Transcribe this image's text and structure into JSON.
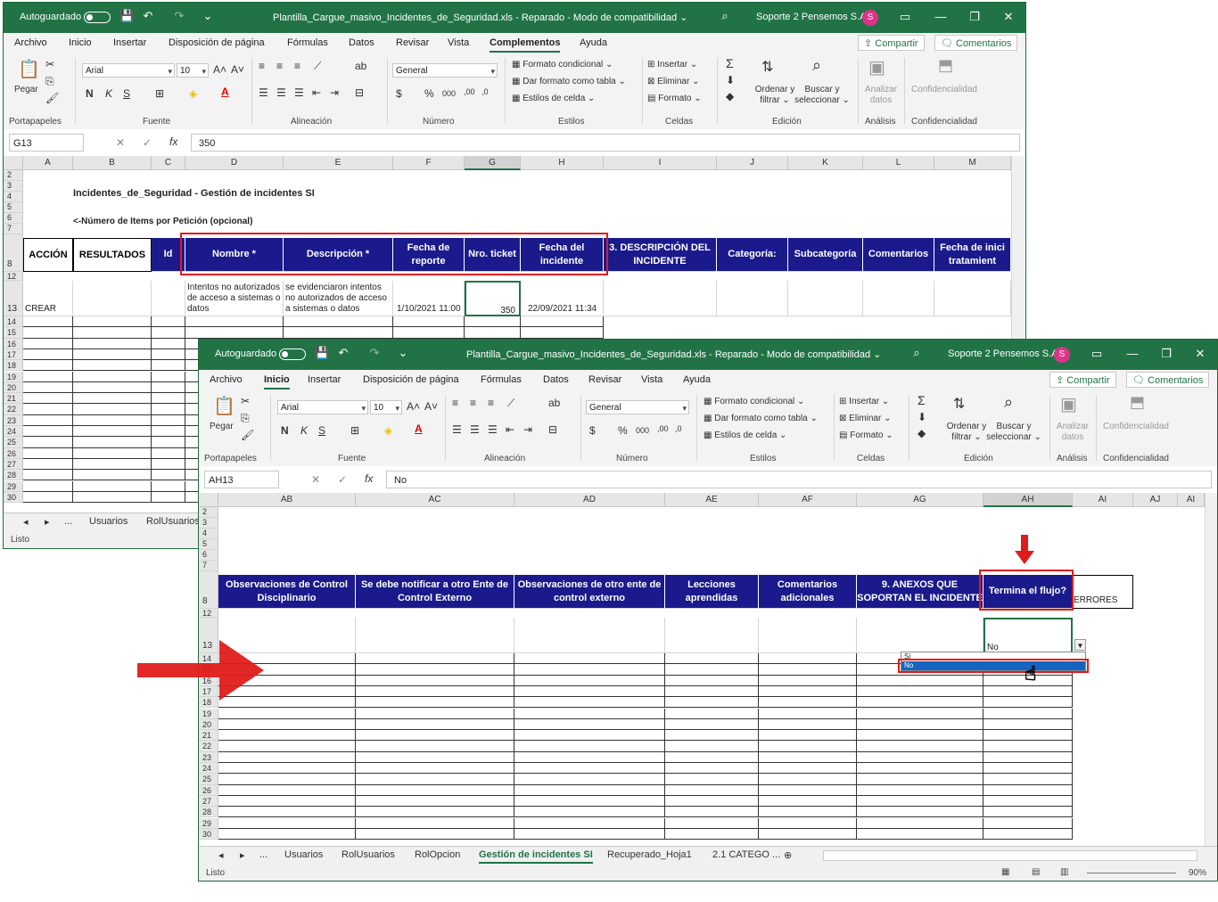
{
  "back": {
    "autosave": "Autoguardado",
    "title": "Plantilla_Cargue_masivo_Incidentes_de_Seguridad.xls  -  Reparado  -  Modo de compatibilidad  ⌄",
    "user": "Soporte 2 Pensemos S.A.",
    "avatar": "S",
    "menu": [
      "Archivo",
      "Inicio",
      "Insertar",
      "Disposición de página",
      "Fórmulas",
      "Datos",
      "Revisar",
      "Vista",
      "Complementos",
      "Ayuda"
    ],
    "share": "Compartir",
    "comments": "Comentarios",
    "font": "Arial",
    "size": "10",
    "numfmt": "General",
    "namebox": "G13",
    "formula": "350",
    "cols": [
      "A",
      "B",
      "C",
      "D",
      "E",
      "F",
      "G",
      "H",
      "I",
      "J",
      "K",
      "L",
      "M"
    ],
    "rows_top": [
      "2",
      "3",
      "4",
      "5",
      "6",
      "7"
    ],
    "sheet_title": "Incidentes_de_Seguridad - Gestión de incidentes SI",
    "items_note": "<-Número de Items por Petición (opcional)",
    "headers": [
      "ACCIÓN",
      "RESULTADOS",
      "Id",
      "Nombre *",
      "Descripción *",
      "Fecha de reporte",
      "Nro. ticket",
      "Fecha del incidente",
      "3. DESCRIPCIÓN DEL INCIDENTE",
      "Categoría:",
      "Subcategoría",
      "Comentarios",
      "Fecha de inici tratamient"
    ],
    "row13": {
      "accion": "CREAR",
      "nombre": "Intentos no autorizados de acceso a sistemas o datos",
      "descripcion": "se evidenciaron intentos no autorizados de acceso a sistemas o datos",
      "fecha_reporte": "1/10/2021 11:00",
      "ticket": "350",
      "fecha_incidente": "22/09/2021 11:34"
    },
    "rows_bottom": [
      "14",
      "15",
      "16",
      "17",
      "18",
      "19",
      "20",
      "21",
      "22",
      "23",
      "24",
      "25",
      "26",
      "27",
      "28",
      "29",
      "30"
    ],
    "tabs": [
      "Usuarios",
      "RolUsuarios"
    ],
    "status": "Listo"
  },
  "front": {
    "autosave": "Autoguardado",
    "title": "Plantilla_Cargue_masivo_Incidentes_de_Seguridad.xls  -  Reparado  -  Modo de compatibilidad  ⌄",
    "user": "Soporte 2 Pensemos S.A.",
    "avatar": "S",
    "menu": [
      "Archivo",
      "Inicio",
      "Insertar",
      "Disposición de página",
      "Fórmulas",
      "Datos",
      "Revisar",
      "Vista",
      "Ayuda"
    ],
    "share": "Compartir",
    "comments": "Comentarios",
    "font": "Arial",
    "size": "10",
    "numfmt": "General",
    "namebox": "AH13",
    "formula": "No",
    "cols": [
      "AB",
      "AC",
      "AD",
      "AE",
      "AF",
      "AG",
      "AH",
      "AI",
      "AJ",
      "AI"
    ],
    "rows_top": [
      "2",
      "3",
      "4",
      "5",
      "6",
      "7"
    ],
    "headers": [
      "Observaciones de Control Disciplinario",
      "Se debe notificar a otro Ente de Control Externo",
      "Observaciones de otro ente de control externo",
      "Lecciones aprendidas",
      "Comentarios adicionales",
      "9. ANEXOS QUE SOPORTAN EL INCIDENTE",
      "Termina el flujo?",
      "ERRORES"
    ],
    "cell_value": "No",
    "dropdown": [
      "Si",
      "No"
    ],
    "rows_bottom": [
      "14",
      "15",
      "16",
      "17",
      "18",
      "19",
      "20",
      "21",
      "22",
      "23",
      "24",
      "25",
      "26",
      "27",
      "28",
      "29",
      "30"
    ],
    "tabs": [
      "Usuarios",
      "RolUsuarios",
      "RolOpcion",
      "Gestión de incidentes SI",
      "Recuperado_Hoja1",
      "2.1 CATEGO ..."
    ],
    "status": "Listo",
    "zoom": "90%"
  },
  "ribbon_labels": {
    "paste": "Pegar",
    "clipboard": "Portapapeles",
    "font_group": "Fuente",
    "align": "Alineación",
    "number": "Número",
    "styles": "Estilos",
    "cells": "Celdas",
    "edit": "Edición",
    "analysis": "Análisis",
    "conf": "Confidencialidad",
    "cond_format": "Formato condicional ⌄",
    "table_format": "Dar formato como tabla ⌄",
    "cell_styles": "Estilos de celda ⌄",
    "insert": "Insertar",
    "delete": "Eliminar",
    "format": "Formato",
    "sort": "Ordenar y filtrar ⌄",
    "find": "Buscar y seleccionar ⌄",
    "analyze": "Analizar datos",
    "conf_btn": "Confidencialidad"
  },
  "colors": {
    "excel_green": "#217346",
    "header_blue": "#1a1a8c",
    "highlight_red": "#e01b1b",
    "dropdown_blue": "#1565c0"
  }
}
